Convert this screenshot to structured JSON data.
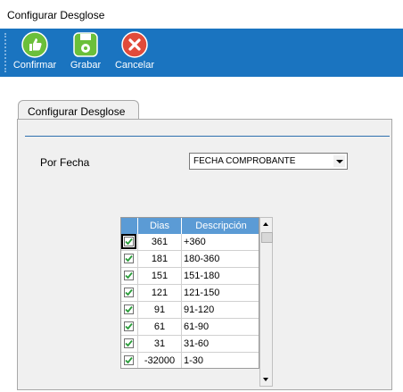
{
  "window": {
    "title": "Configurar Desglose"
  },
  "toolbar": {
    "buttons": [
      {
        "label": "Confirmar",
        "icon": "thumbs-up-icon",
        "color": "#6bbf3a"
      },
      {
        "label": "Grabar",
        "icon": "floppy-disk-icon",
        "color": "#6bbf3a"
      },
      {
        "label": "Cancelar",
        "icon": "cancel-x-icon",
        "color": "#e14b3b"
      }
    ]
  },
  "tab": {
    "label": "Configurar Desglose"
  },
  "form": {
    "fecha_label": "Por Fecha",
    "fecha_value": "FECHA COMPROBANTE"
  },
  "grid": {
    "columns": [
      "Dias",
      "Descripción"
    ],
    "rows": [
      {
        "checked": true,
        "dias": "361",
        "descripcion": "+360"
      },
      {
        "checked": true,
        "dias": "181",
        "descripcion": "180-360"
      },
      {
        "checked": true,
        "dias": "151",
        "descripcion": "151-180"
      },
      {
        "checked": true,
        "dias": "121",
        "descripcion": "121-150"
      },
      {
        "checked": true,
        "dias": "91",
        "descripcion": "91-120"
      },
      {
        "checked": true,
        "dias": "61",
        "descripcion": "61-90"
      },
      {
        "checked": true,
        "dias": "31",
        "descripcion": "31-60"
      },
      {
        "checked": true,
        "dias": "-32000",
        "descripcion": "1-30"
      }
    ]
  },
  "colors": {
    "toolbar": "#1a74c0",
    "header": "#5b9bd5",
    "check": "#2a9d3a"
  }
}
